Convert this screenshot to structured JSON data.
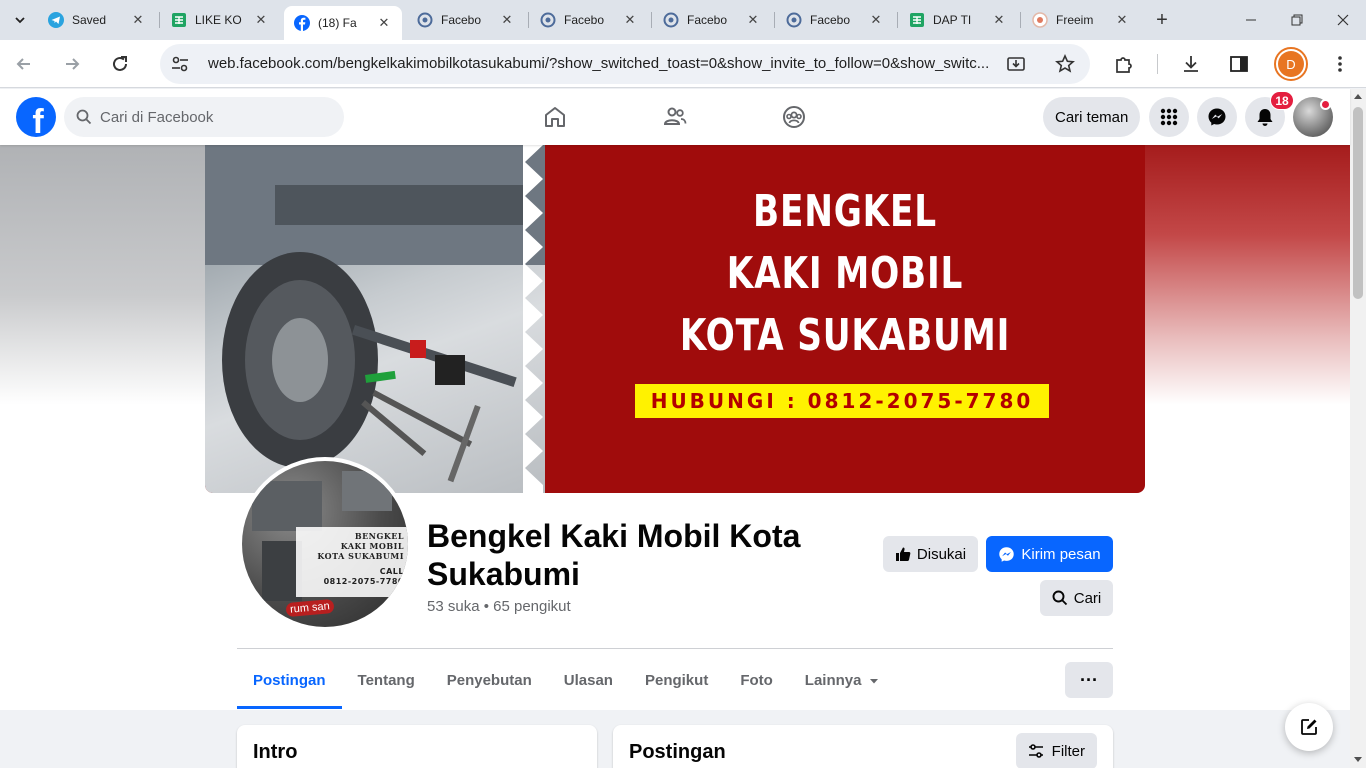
{
  "browser": {
    "tabs": [
      {
        "title": "Saved",
        "icon": "telegram-icon"
      },
      {
        "title": "LIKE KO",
        "icon": "google-sheets-icon"
      },
      {
        "title": "(18) Fa",
        "icon": "facebook-icon"
      },
      {
        "title": "Facebo",
        "icon": "web-icon"
      },
      {
        "title": "Facebo",
        "icon": "web-icon"
      },
      {
        "title": "Facebo",
        "icon": "web-icon"
      },
      {
        "title": "Facebo",
        "icon": "web-icon"
      },
      {
        "title": "DAP TI",
        "icon": "google-sheets-icon"
      },
      {
        "title": "Freeim",
        "icon": "freeimage-icon"
      }
    ],
    "url": "web.facebook.com/bengkelkakimobilkotasukabumi/?show_switched_toast=0&show_invite_to_follow=0&show_switc...",
    "profile_initial": "D",
    "profile_color": "#e87522"
  },
  "fb": {
    "search_placeholder": "Cari di Facebook",
    "find_friends": "Cari teman",
    "notification_count": "18",
    "brand_color": "#0866ff"
  },
  "cover": {
    "line1": "BENGKEL",
    "line2": "KAKI MOBIL",
    "line3": "KOTA SUKABUMI",
    "phone": "HUBUNGI : 0812-2075-7780",
    "bg_color": "#a00c0c",
    "phone_bg": "#fff200"
  },
  "profile_pic": {
    "line1": "BENGKEL",
    "line2": "KAKI MOBIL",
    "line3": "KOTA SUKABUMI",
    "call": "CALL",
    "phone": "0812-2075-7780",
    "logo": "rum san"
  },
  "page": {
    "name": "Bengkel Kaki Mobil Kota Sukabumi",
    "stats": "53 suka • 65 pengikut",
    "liked_label": "Disukai",
    "message_label": "Kirim pesan",
    "search_label": "Cari",
    "tabs": [
      "Postingan",
      "Tentang",
      "Penyebutan",
      "Ulasan",
      "Pengikut",
      "Foto",
      "Lainnya"
    ],
    "more_label": "···"
  },
  "intro": {
    "title": "Intro"
  },
  "posts": {
    "title": "Postingan",
    "filter_label": "Filter"
  }
}
